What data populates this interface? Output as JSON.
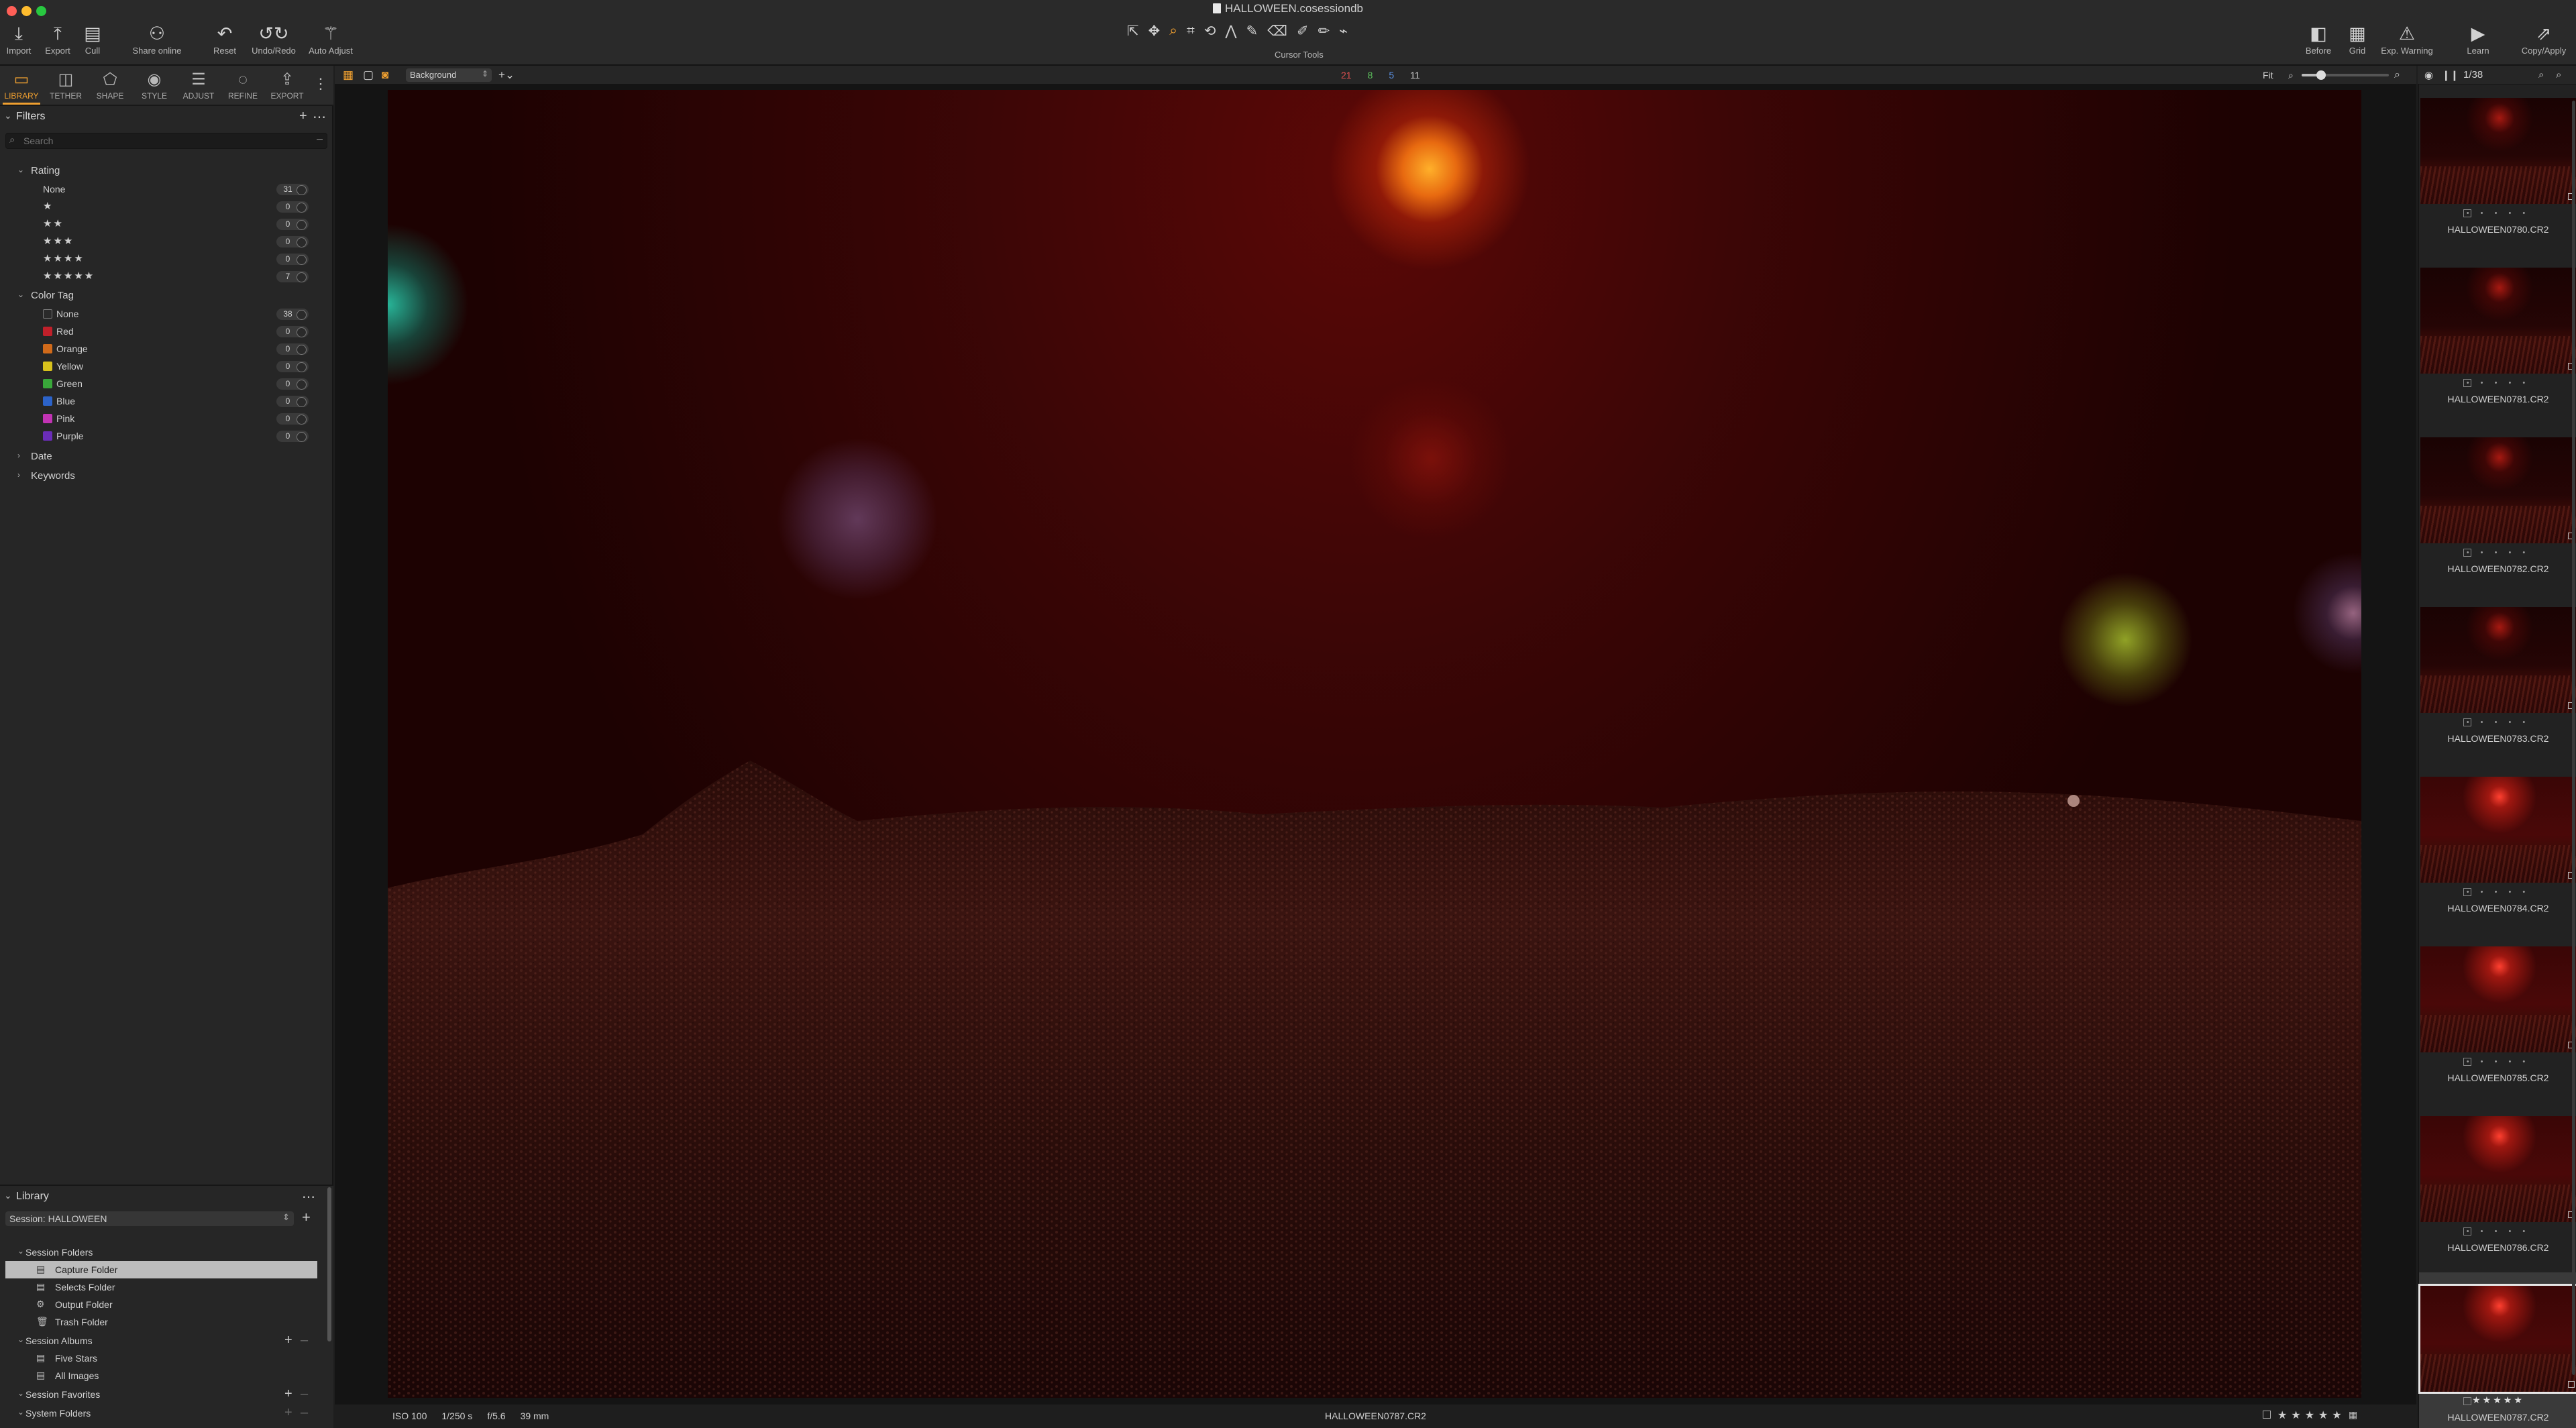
{
  "window": {
    "title": "HALLOWEEN.cosessiondb"
  },
  "toolbar": {
    "left_tools": [
      {
        "label": "Import",
        "icon": "import-icon"
      },
      {
        "label": "Export",
        "icon": "export-icon"
      },
      {
        "label": "Cull",
        "icon": "cull-icon"
      },
      {
        "label": "Share online",
        "icon": "share-icon"
      },
      {
        "label": "Reset",
        "icon": "reset-icon"
      },
      {
        "label": "Undo/Redo",
        "icon": "undo-redo-icon"
      },
      {
        "label": "Auto Adjust",
        "icon": "auto-adjust-icon"
      }
    ],
    "cursor_tools_label": "Cursor Tools",
    "right_tools": [
      {
        "label": "Before",
        "icon": "before-icon"
      },
      {
        "label": "Grid",
        "icon": "grid-icon"
      },
      {
        "label": "Exp. Warning",
        "icon": "exposure-warning-icon"
      },
      {
        "label": "Learn",
        "icon": "learn-icon"
      },
      {
        "label": "Copy/Apply",
        "icon": "copy-apply-icon"
      }
    ]
  },
  "tool_tabs": [
    {
      "label": "LIBRARY",
      "active": true
    },
    {
      "label": "TETHER"
    },
    {
      "label": "SHAPE"
    },
    {
      "label": "STYLE"
    },
    {
      "label": "ADJUST"
    },
    {
      "label": "REFINE"
    },
    {
      "label": "EXPORT"
    }
  ],
  "filters": {
    "title": "Filters",
    "search_placeholder": "Search",
    "rating": {
      "title": "Rating",
      "rows": [
        {
          "label": "None",
          "count": "31"
        },
        {
          "stars": "★",
          "count": "0"
        },
        {
          "stars": "★★",
          "count": "0"
        },
        {
          "stars": "★★★",
          "count": "0"
        },
        {
          "stars": "★★★★",
          "count": "0"
        },
        {
          "stars": "★★★★★",
          "count": "7"
        }
      ]
    },
    "color_tag": {
      "title": "Color Tag",
      "rows": [
        {
          "label": "None",
          "count": "38",
          "color": "#2a2a2a"
        },
        {
          "label": "Red",
          "count": "0",
          "color": "#c0202a"
        },
        {
          "label": "Orange",
          "count": "0",
          "color": "#d06a1a"
        },
        {
          "label": "Yellow",
          "count": "0",
          "color": "#d8c21c"
        },
        {
          "label": "Green",
          "count": "0",
          "color": "#39a83a"
        },
        {
          "label": "Blue",
          "count": "0",
          "color": "#2c63c9"
        },
        {
          "label": "Pink",
          "count": "0",
          "color": "#c233b4"
        },
        {
          "label": "Purple",
          "count": "0",
          "color": "#6a2db8"
        }
      ]
    },
    "date": "Date",
    "keywords": "Keywords"
  },
  "library": {
    "title": "Library",
    "session": "Session: HALLOWEEN",
    "session_folders": {
      "title": "Session Folders",
      "items": [
        {
          "label": "Capture Folder",
          "selected": true
        },
        {
          "label": "Selects Folder"
        },
        {
          "label": "Output Folder"
        },
        {
          "label": "Trash Folder"
        }
      ]
    },
    "session_albums": {
      "title": "Session Albums",
      "items": [
        {
          "label": "Five Stars"
        },
        {
          "label": "All Images"
        }
      ]
    },
    "session_favorites": "Session Favorites",
    "system_folders": "System Folders"
  },
  "viewer": {
    "layer": "Background",
    "counts": [
      {
        "value": "21",
        "color": "#e05050"
      },
      {
        "value": "8",
        "color": "#5cc05c"
      },
      {
        "value": "5",
        "color": "#5a8fe0"
      },
      {
        "value": "11",
        "color": "#d0d0d0"
      }
    ],
    "fit": "Fit",
    "zoom_level": 0.22,
    "image_count": "1/38",
    "meta": {
      "iso": "ISO 100",
      "shutter": "1/250 s",
      "aperture": "f/5.6",
      "focal": "39 mm"
    },
    "filename": "HALLOWEEN0787.CR2",
    "rating": "★★★★★"
  },
  "browser": {
    "thumbnails": [
      {
        "name": "HALLOWEEN0780.CR2",
        "stars": "• • • • •"
      },
      {
        "name": "HALLOWEEN0781.CR2",
        "stars": "• • • • •"
      },
      {
        "name": "HALLOWEEN0782.CR2",
        "stars": "• • • • •"
      },
      {
        "name": "HALLOWEEN0783.CR2",
        "stars": "• • • • •"
      },
      {
        "name": "HALLOWEEN0784.CR2",
        "stars": "• • • • •"
      },
      {
        "name": "HALLOWEEN0785.CR2",
        "stars": "• • • • •"
      },
      {
        "name": "HALLOWEEN0786.CR2",
        "stars": "• • • • •"
      },
      {
        "name": "HALLOWEEN0787.CR2",
        "stars": "★★★★★",
        "selected": true
      }
    ]
  }
}
